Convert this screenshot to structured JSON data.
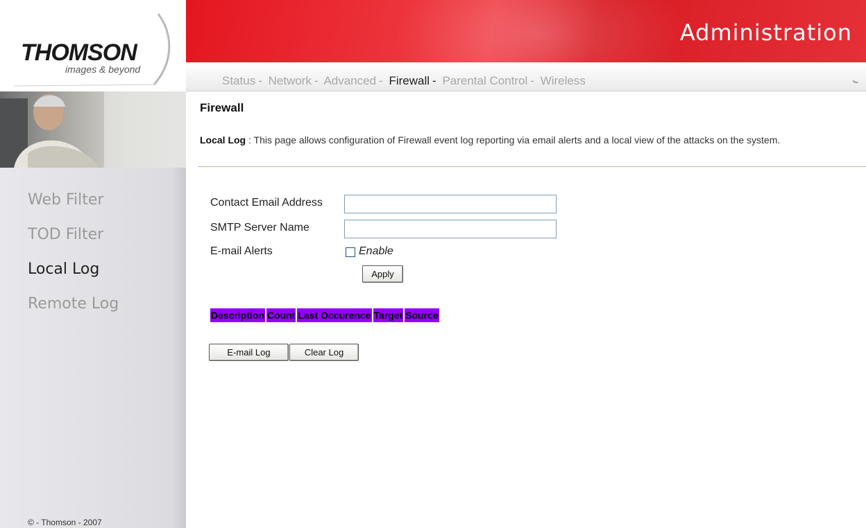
{
  "brand": {
    "name": "THOMSON",
    "tagline": "images & beyond"
  },
  "header": {
    "title": "Administration"
  },
  "nav": {
    "items": [
      {
        "label": "Status",
        "active": false
      },
      {
        "label": "Network",
        "active": false
      },
      {
        "label": "Advanced",
        "active": false
      },
      {
        "label": "Firewall",
        "active": true
      },
      {
        "label": "Parental Control",
        "active": false
      },
      {
        "label": "Wireless",
        "active": false
      }
    ],
    "separator": "-"
  },
  "sidebar": {
    "items": [
      {
        "label": "Web Filter",
        "active": false
      },
      {
        "label": "TOD Filter",
        "active": false
      },
      {
        "label": "Local Log",
        "active": true
      },
      {
        "label": "Remote Log",
        "active": false
      }
    ],
    "footer": "© - Thomson - 2007"
  },
  "main": {
    "title": "Firewall",
    "intro_key": "Local Log",
    "intro_colon": " : ",
    "intro_text": "This page allows configuration of Firewall event log reporting via email alerts and a local view of the attacks on the system."
  },
  "form": {
    "email_label": "Contact Email Address",
    "email_value": "",
    "smtp_label": "SMTP Server Name",
    "smtp_value": "",
    "alerts_label": "E-mail Alerts",
    "enable_label": "Enable",
    "enable_checked": false,
    "apply_label": "Apply"
  },
  "log_table": {
    "headers": [
      "Description",
      "Count",
      "Last Occurence",
      "Target",
      "Source"
    ],
    "header_color": "#9400ff"
  },
  "actions": {
    "email_log_label": "E-mail Log",
    "clear_log_label": "Clear Log"
  },
  "colors": {
    "header_red": "#e4161f"
  }
}
